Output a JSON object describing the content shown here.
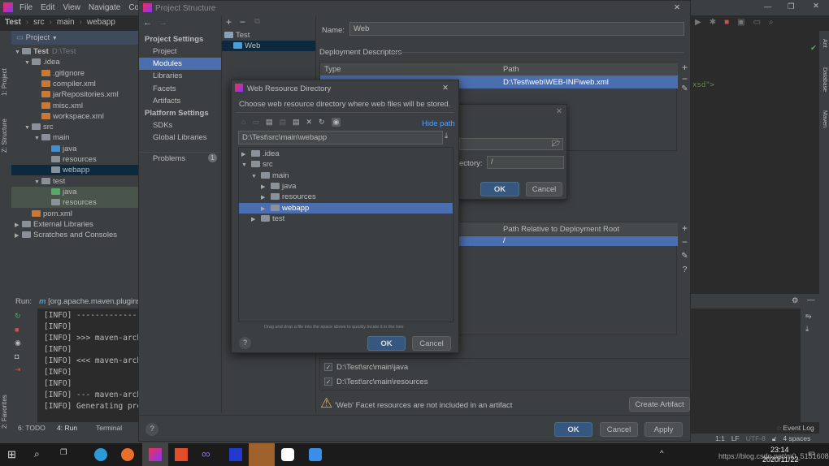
{
  "ide": {
    "menu": [
      "File",
      "Edit",
      "View",
      "Navigate",
      "Code"
    ],
    "breadcrumb": [
      "Test",
      "src",
      "main",
      "webapp"
    ],
    "project_panel_title": "Project",
    "tool_stripe": {
      "project": "1: Project",
      "structure": "Z: Structure",
      "favorites": "2: Favorites"
    },
    "tree": [
      {
        "label": "Test",
        "extra": "D:\\Test",
        "depth": 0,
        "fold": "▼"
      },
      {
        "label": ".idea",
        "depth": 1,
        "fold": "▼"
      },
      {
        "label": ".gitignore",
        "depth": 2,
        "fold": ""
      },
      {
        "label": "compiler.xml",
        "depth": 2,
        "fold": ""
      },
      {
        "label": "jarRepositories.xml",
        "depth": 2,
        "fold": ""
      },
      {
        "label": "misc.xml",
        "depth": 2,
        "fold": ""
      },
      {
        "label": "workspace.xml",
        "depth": 2,
        "fold": ""
      },
      {
        "label": "src",
        "depth": 1,
        "fold": "▼"
      },
      {
        "label": "main",
        "depth": 2,
        "fold": "▼"
      },
      {
        "label": "java",
        "depth": 3,
        "fold": ""
      },
      {
        "label": "resources",
        "depth": 3,
        "fold": ""
      },
      {
        "label": "webapp",
        "depth": 3,
        "fold": "",
        "selected": true
      },
      {
        "label": "test",
        "depth": 2,
        "fold": "▼"
      },
      {
        "label": "java",
        "depth": 3,
        "fold": "",
        "test": true
      },
      {
        "label": "resources",
        "depth": 3,
        "fold": "",
        "test": true
      },
      {
        "label": "pom.xml",
        "depth": 1,
        "fold": ""
      },
      {
        "label": "External Libraries",
        "depth": 0,
        "fold": "▶"
      },
      {
        "label": "Scratches and Consoles",
        "depth": 0,
        "fold": "▶"
      }
    ],
    "run": {
      "label": "Run:",
      "config": "[org.apache.maven.plugins:",
      "lines": [
        "[INFO] ---------------",
        "[INFO]",
        "[INFO] >>> maven-arche",
        "[INFO]",
        "[INFO] <<< maven-arche",
        "[INFO]",
        "[INFO]",
        "[INFO] --- maven-arche",
        "[INFO] Generating proj"
      ]
    },
    "bottom_tabs": [
      "6: TODO",
      "4: Run",
      "Terminal"
    ],
    "editor_snippet": "xsd\">",
    "right_stripe": [
      "Ant",
      "Database",
      "Maven"
    ],
    "status": {
      "event_log": "Event Log",
      "position": "1:1",
      "line_sep": "LF",
      "encoding": "UTF-8",
      "indent": "4 spaces"
    }
  },
  "project_structure": {
    "title": "Project Structure",
    "sections": [
      {
        "header": "Project Settings",
        "items": [
          "Project",
          "Modules",
          "Libraries",
          "Facets",
          "Artifacts"
        ]
      },
      {
        "header": "Platform Settings",
        "items": [
          "SDKs",
          "Global Libraries"
        ]
      }
    ],
    "selected_item": "Modules",
    "problems": {
      "label": "Problems",
      "count": "1"
    },
    "modules": [
      {
        "label": "Test"
      },
      {
        "label": "Web",
        "selected": true
      }
    ],
    "name_label": "Name:",
    "name_value": "Web",
    "deployment_descriptors": {
      "title": "Deployment Descriptors",
      "columns": [
        "Type",
        "Path"
      ],
      "row": {
        "type": "",
        "path": "D:\\Test\\web\\WEB-INF\\web.xml"
      }
    },
    "web_roots": {
      "columns": [
        "",
        "Path Relative to Deployment Root"
      ],
      "row": {
        "dir": "",
        "path": "/"
      }
    },
    "source_roots": [
      {
        "path": "D:\\Test\\src\\main\\java",
        "checked": true
      },
      {
        "path": "D:\\Test\\src\\main\\resources",
        "checked": true
      }
    ],
    "warning": "'Web' Facet resources are not included in an artifact",
    "create_artifact": "Create Artifact",
    "ok": "OK",
    "cancel": "Cancel",
    "apply": "Apply"
  },
  "back_dialog": {
    "dir_label": "ectory:",
    "dir_value": "/",
    "ok": "OK",
    "cancel": "Cancel"
  },
  "web_resource_dialog": {
    "title": "Web Resource Directory",
    "description": "Choose web resource directory where web files will be stored.",
    "hide_path": "Hide path",
    "path_value": "D:\\Test\\src\\main\\webapp",
    "tree": [
      {
        "label": ".idea",
        "depth": 0,
        "fold": "▶"
      },
      {
        "label": "src",
        "depth": 0,
        "fold": "▼"
      },
      {
        "label": "main",
        "depth": 1,
        "fold": "▼"
      },
      {
        "label": "java",
        "depth": 2,
        "fold": "▶"
      },
      {
        "label": "resources",
        "depth": 2,
        "fold": "▶"
      },
      {
        "label": "webapp",
        "depth": 2,
        "fold": "▶",
        "selected": true
      },
      {
        "label": "test",
        "depth": 1,
        "fold": "▶"
      }
    ],
    "hint": "Drag and drop a file into the space above to quickly locate it in the tree",
    "ok": "OK",
    "cancel": "Cancel"
  },
  "taskbar": {
    "time": "23:14",
    "date": "2020/11/22",
    "watermark": "https://blog.csdn.net/m0_51516085"
  },
  "colors": {
    "selection": "#4b6eaf",
    "primary_button": "#365880",
    "warning": "#f0a732",
    "link": "#589df6"
  }
}
